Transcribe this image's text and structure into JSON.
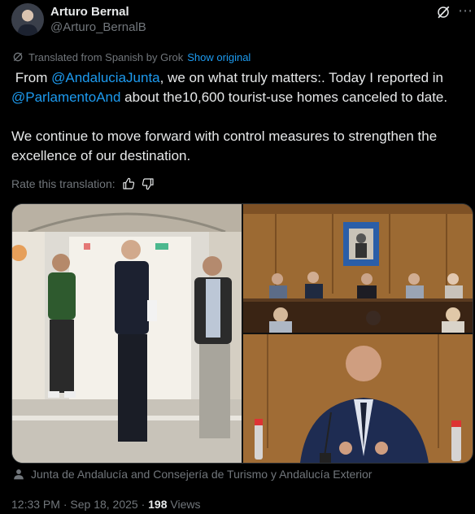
{
  "author": {
    "name": "Arturo Bernal",
    "handle": "@Arturo_BernalB"
  },
  "translation": {
    "note": "Translated from Spanish by Grok",
    "show_original": "Show original",
    "rate_label": "Rate this translation:"
  },
  "tweet": {
    "p1_prefix": " From ",
    "mention1": "@AndaluciaJunta",
    "p1_mid": ", we on what truly matters:. Today I reported in ",
    "mention2": "@ParlamentoAnd",
    "p1_suffix": " about the10,600 tourist-use homes canceled to date.",
    "p2": "We continue to move forward with control measures to strengthen the excellence of our destination."
  },
  "media": {
    "credit": "Junta de Andalucía and Consejería de Turismo y Andalucía Exterior"
  },
  "meta": {
    "time": "12:33 PM",
    "separator": "·",
    "date": "Sep 18, 2025",
    "views_count": "198",
    "views_label": "Views"
  },
  "colors": {
    "accent": "#1d9bf0",
    "muted": "#71767b",
    "text": "#e7e9ea",
    "background": "#000000"
  },
  "icons": [
    "grok-icon",
    "more-icon",
    "translate-icon",
    "thumbs-up-icon",
    "thumbs-down-icon",
    "person-icon"
  ]
}
